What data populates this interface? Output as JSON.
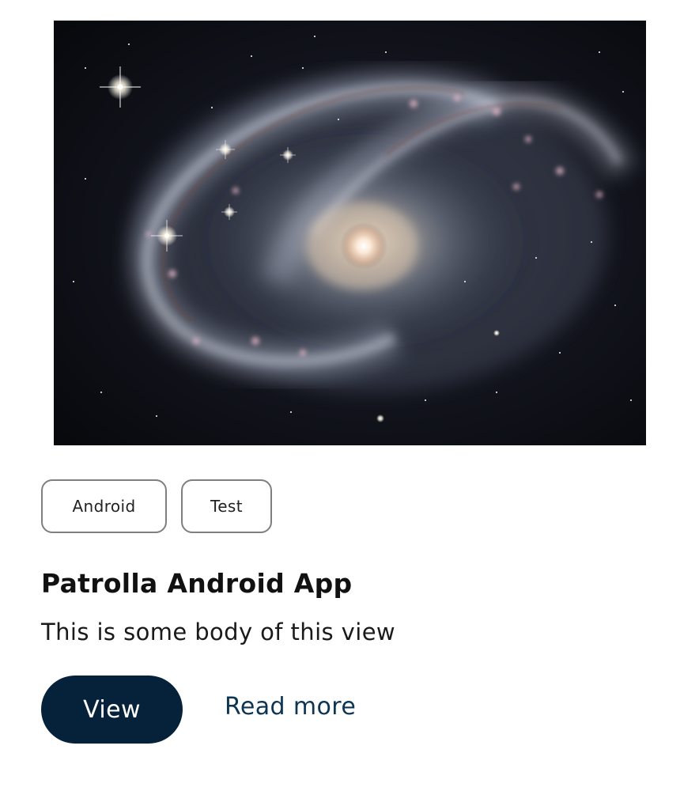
{
  "card": {
    "image": {
      "alt": "Barred spiral galaxy",
      "icon": "galaxy-image"
    },
    "tags": [
      {
        "label": "Android"
      },
      {
        "label": "Test"
      }
    ],
    "title": "Patrolla Android App",
    "body": "This is some body of this view",
    "actions": {
      "view_label": "View",
      "read_more_label": "Read more"
    }
  },
  "colors": {
    "primary_button": "#05223a",
    "link": "#0d3553",
    "tag_border": "#7f7f7f",
    "text": "#111111",
    "background": "#ffffff"
  }
}
